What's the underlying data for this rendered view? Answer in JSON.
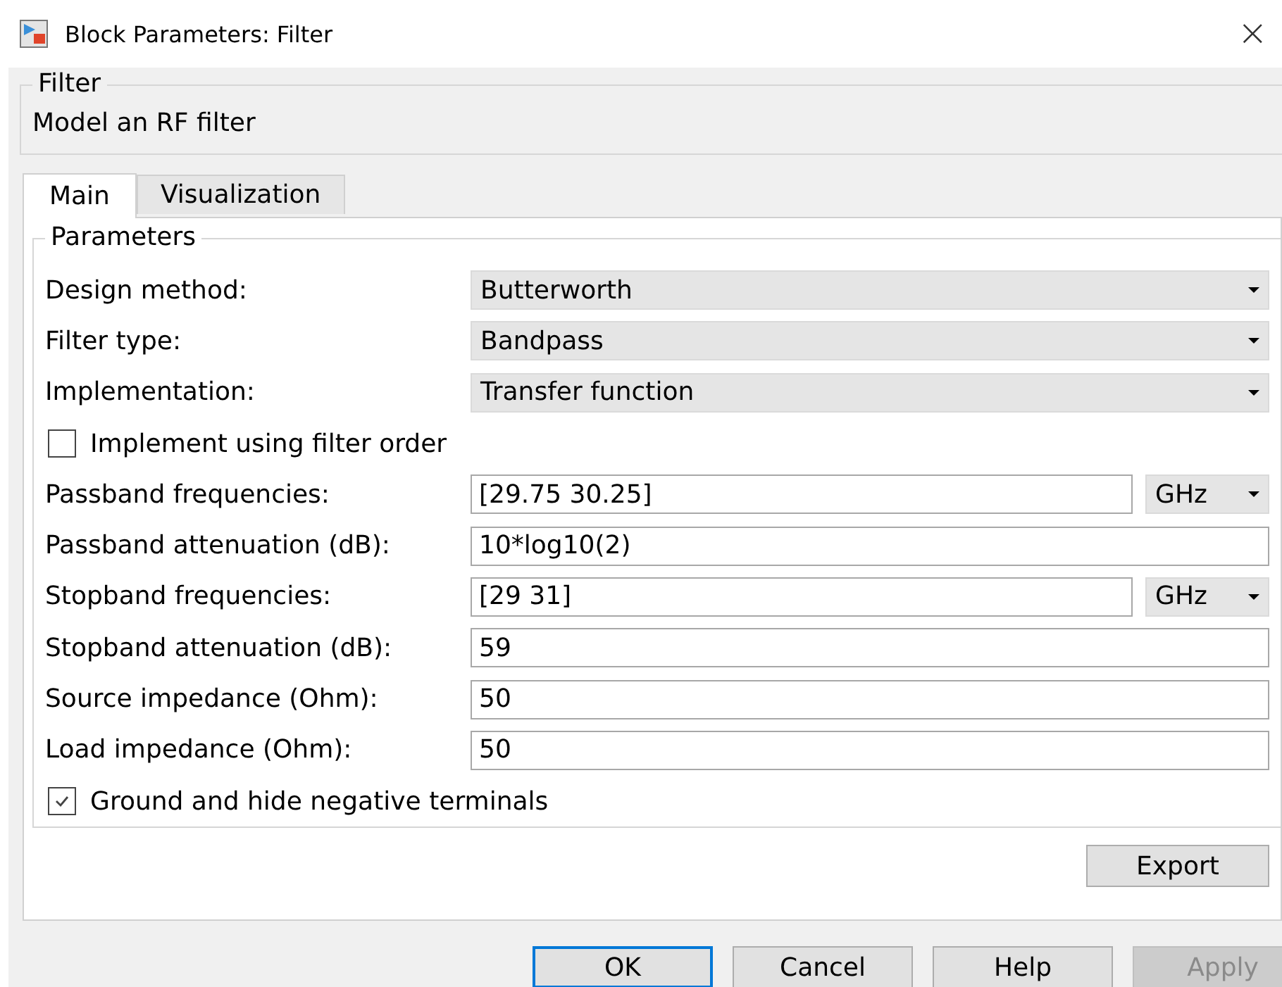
{
  "window": {
    "title": "Block Parameters: Filter",
    "close": "×"
  },
  "block_group": {
    "title": "Filter",
    "description": "Model an RF filter"
  },
  "tabs": [
    {
      "label": "Main",
      "selected": true
    },
    {
      "label": "Visualization",
      "selected": false
    }
  ],
  "parameters": {
    "title": "Parameters",
    "rows": [
      {
        "kind": "dropdown",
        "label": "Design method:",
        "value": "Butterworth"
      },
      {
        "kind": "dropdown",
        "label": "Filter type:",
        "value": "Bandpass"
      },
      {
        "kind": "dropdown",
        "label": "Implementation:",
        "value": "Transfer function"
      },
      {
        "kind": "checkbox",
        "label": "Implement using filter order",
        "checked": false
      },
      {
        "kind": "text",
        "label": "Passband frequencies:",
        "value": "[29.75 30.25]",
        "unit": "GHz"
      },
      {
        "kind": "text",
        "label": "Passband attenuation (dB):",
        "value": "10*log10(2)"
      },
      {
        "kind": "text",
        "label": "Stopband frequencies:",
        "value": "[29 31]",
        "unit": "GHz"
      },
      {
        "kind": "text",
        "label": "Stopband attenuation (dB):",
        "value": "59"
      },
      {
        "kind": "text",
        "label": "Source impedance (Ohm):",
        "value": "50"
      },
      {
        "kind": "text",
        "label": "Load impedance (Ohm):",
        "value": "50"
      },
      {
        "kind": "checkbox",
        "label": "Ground and hide negative terminals",
        "checked": true
      }
    ]
  },
  "export_button": "Export",
  "buttons": [
    {
      "label": "OK",
      "default": true,
      "disabled": false
    },
    {
      "label": "Cancel",
      "default": false,
      "disabled": false
    },
    {
      "label": "Help",
      "default": false,
      "disabled": false
    },
    {
      "label": "Apply",
      "default": false,
      "disabled": true
    }
  ]
}
